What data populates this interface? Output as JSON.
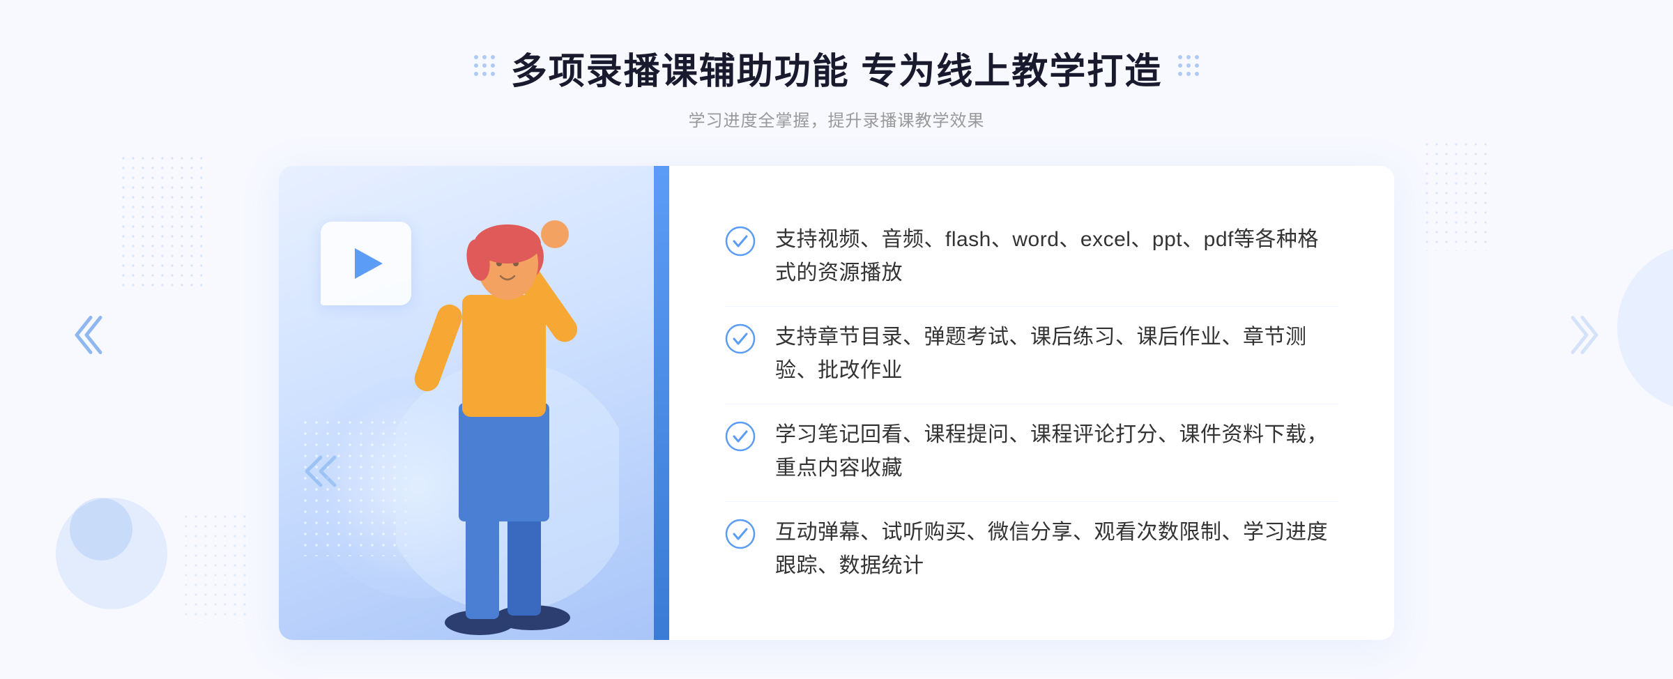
{
  "header": {
    "title": "多项录播课辅助功能 专为线上教学打造",
    "subtitle": "学习进度全掌握，提升录播课教学效果",
    "dots_icon": "⁚ ⁚"
  },
  "features": [
    {
      "id": 1,
      "text": "支持视频、音频、flash、word、excel、ppt、pdf等各种格式的资源播放"
    },
    {
      "id": 2,
      "text": "支持章节目录、弹题考试、课后练习、课后作业、章节测验、批改作业"
    },
    {
      "id": 3,
      "text": "学习笔记回看、课程提问、课程评论打分、课件资料下载，重点内容收藏"
    },
    {
      "id": 4,
      "text": "互动弹幕、试听购买、微信分享、观看次数限制、学习进度跟踪、数据统计"
    }
  ],
  "colors": {
    "primary": "#4a8de8",
    "title": "#1a1a2e",
    "subtitle": "#999999",
    "feature_text": "#333333",
    "check_color": "#5b9cf6",
    "bg": "#f8f9ff",
    "card_bg": "#ffffff"
  },
  "decorations": {
    "chevron_left": "»",
    "chevron_right": "«"
  }
}
